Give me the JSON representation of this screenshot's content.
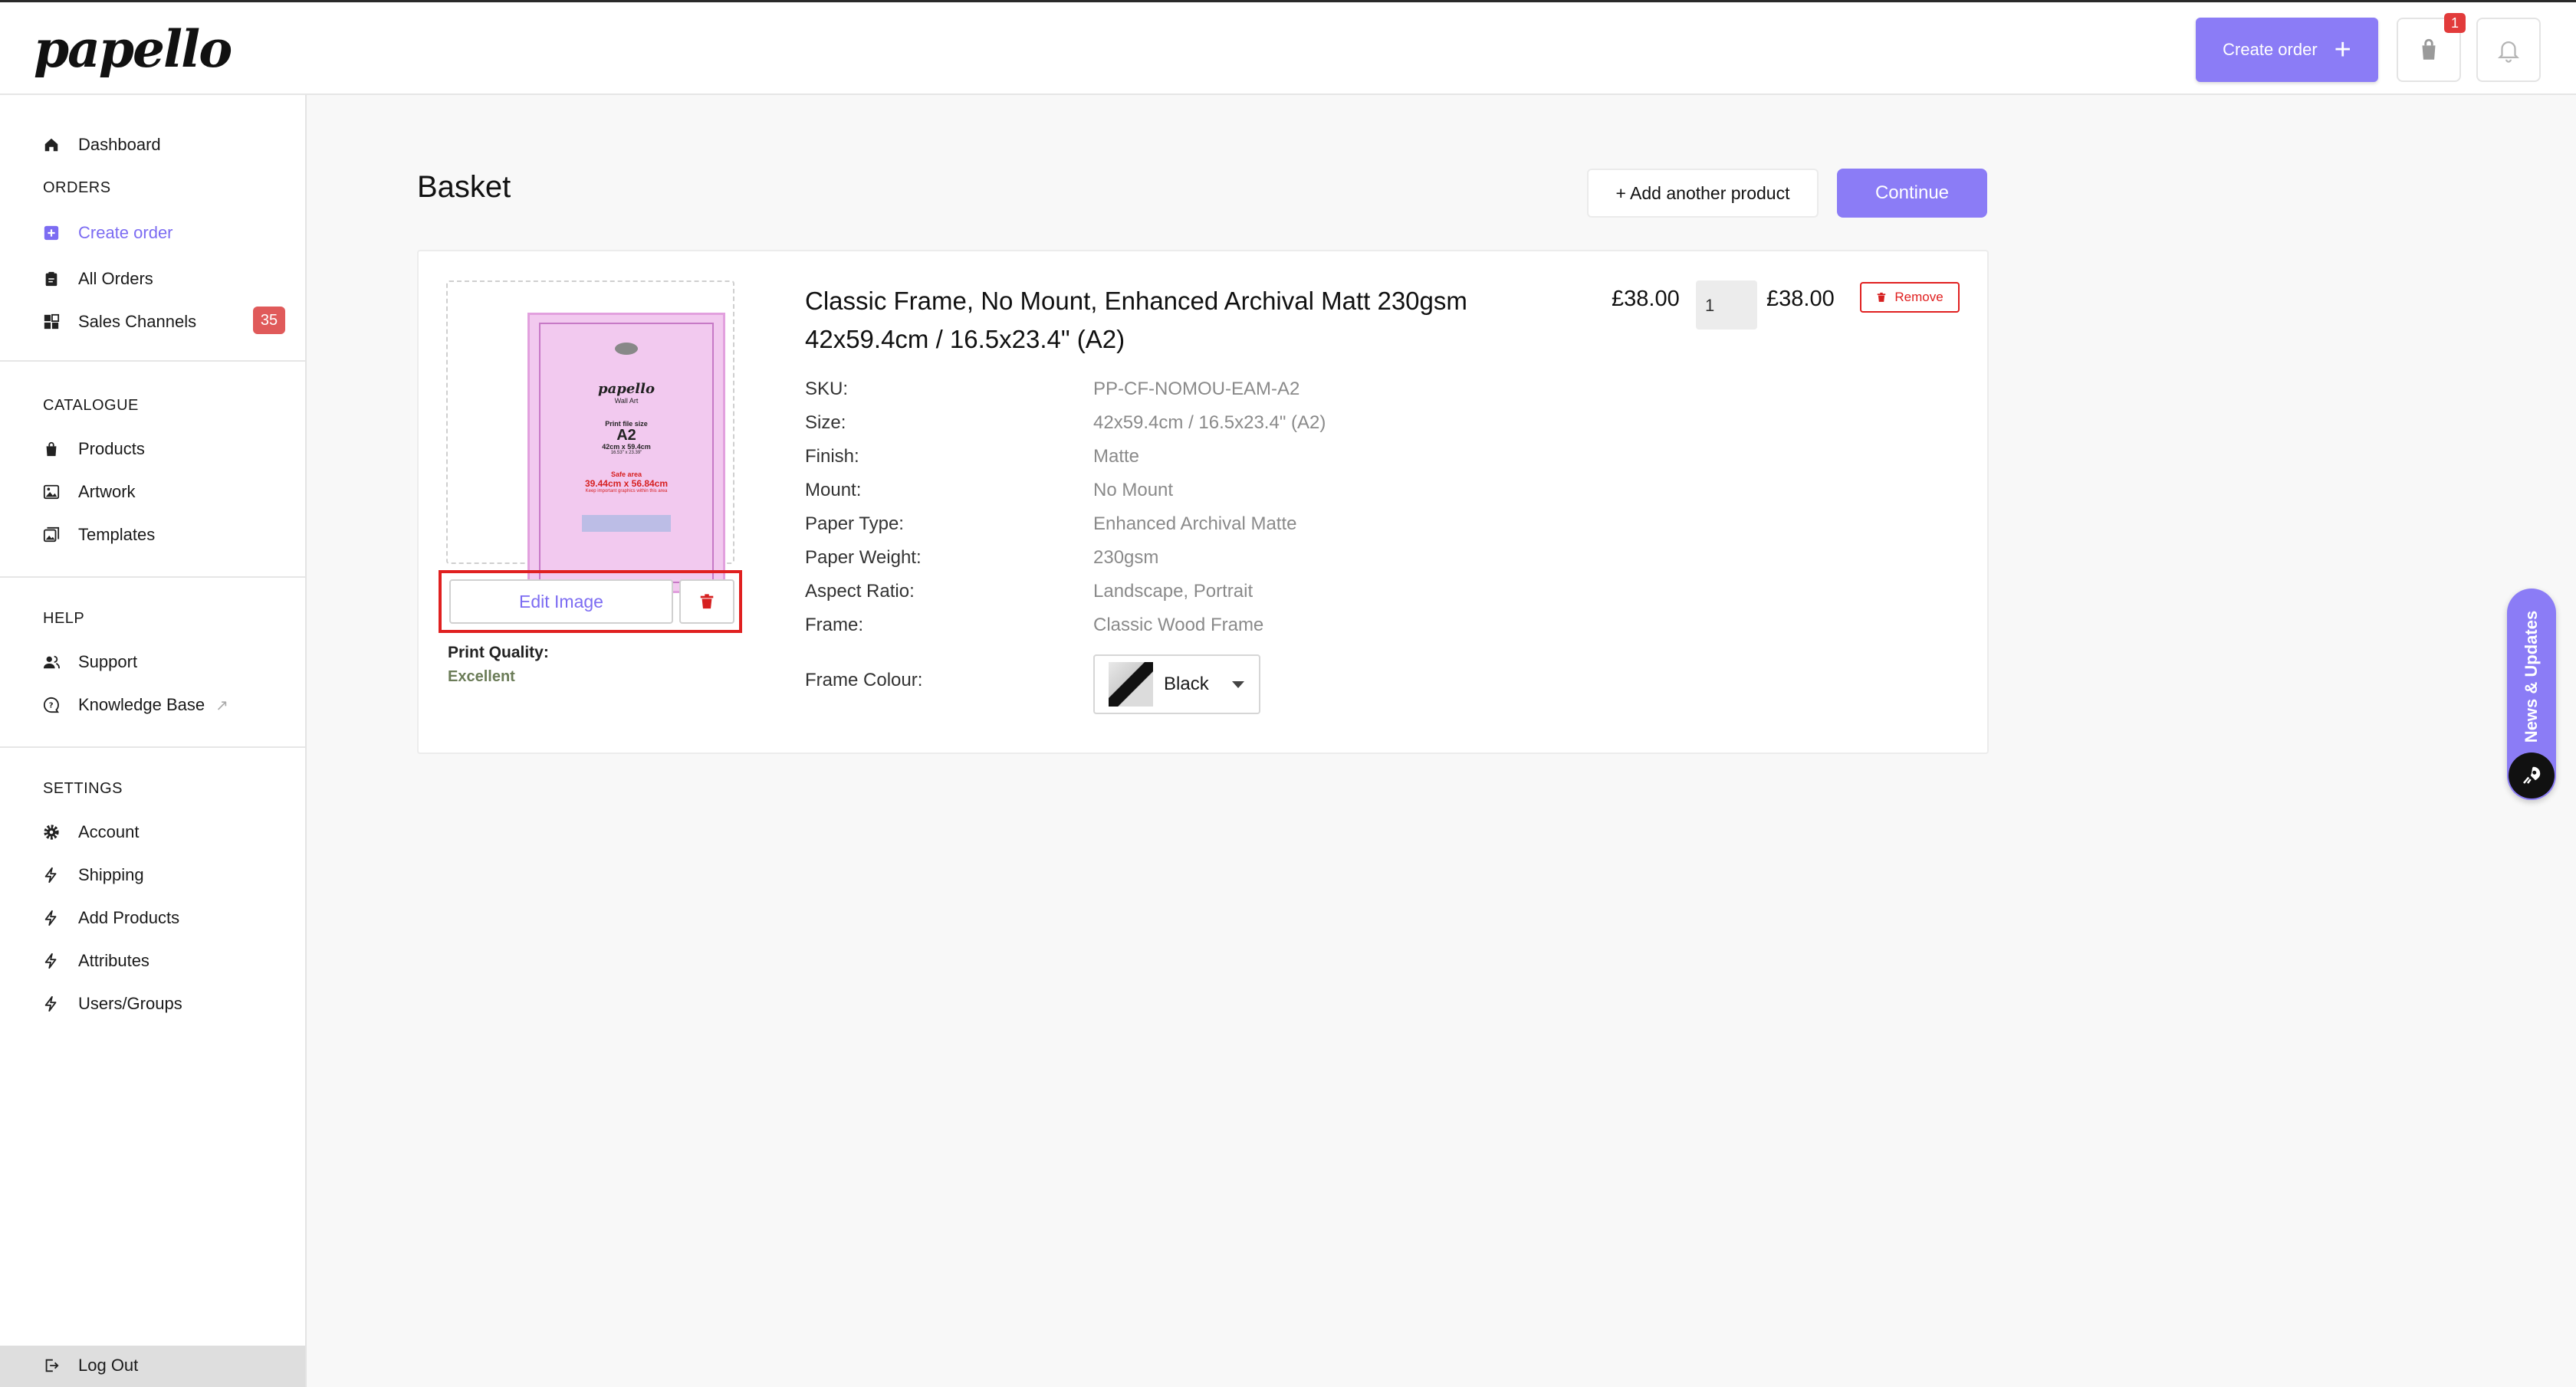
{
  "app": {
    "logo": "papello"
  },
  "header": {
    "create_order_label": "Create order",
    "create_order_icon": "plus-icon",
    "basket_count": "1",
    "basket_icon": "shopping-bag-icon",
    "bell_icon": "bell-icon"
  },
  "sidebar": {
    "dashboard": "Dashboard",
    "orders_header": "ORDERS",
    "create_order": "Create order",
    "all_orders": "All Orders",
    "sales_channels": "Sales Channels",
    "sales_channels_count": "35",
    "catalogue_header": "CATALOGUE",
    "products": "Products",
    "artwork": "Artwork",
    "templates": "Templates",
    "help_header": "HELP",
    "support": "Support",
    "knowledge_base": "Knowledge Base",
    "settings_header": "SETTINGS",
    "account": "Account",
    "shipping": "Shipping",
    "add_products": "Add Products",
    "attributes": "Attributes",
    "users_groups": "Users/Groups",
    "log_out": "Log Out"
  },
  "main": {
    "title": "Basket",
    "add_another_product": "+ Add another product",
    "continue": "Continue"
  },
  "item": {
    "title_line1": "Classic Frame, No Mount, Enhanced Archival Matt 230gsm",
    "title_line2": "42x59.4cm / 16.5x23.4\" (A2)",
    "unit_price": "£38.00",
    "quantity": "1",
    "total_price": "£38.00",
    "remove_label": "Remove",
    "edit_image_label": "Edit Image",
    "print_quality_label": "Print Quality:",
    "print_quality_value": "Excellent",
    "attributes": [
      {
        "key": "SKU:",
        "value": "PP-CF-NOMOU-EAM-A2"
      },
      {
        "key": "Size:",
        "value": "42x59.4cm / 16.5x23.4\" (A2)"
      },
      {
        "key": "Finish:",
        "value": "Matte"
      },
      {
        "key": "Mount:",
        "value": "No Mount"
      },
      {
        "key": "Paper Type:",
        "value": "Enhanced Archival Matte"
      },
      {
        "key": "Paper Weight:",
        "value": "230gsm"
      },
      {
        "key": "Aspect Ratio:",
        "value": "Landscape, Portrait"
      },
      {
        "key": "Frame:",
        "value": "Classic Wood Frame"
      }
    ],
    "frame_colour_label": "Frame Colour:",
    "frame_colour_value": "Black"
  },
  "poster": {
    "logo": "papello",
    "subtitle": "Wall Art",
    "print_file_size": "Print file size",
    "size_name": "A2",
    "size_cm": "42cm x 59.4cm",
    "size_in": "16.53\" x 23.39\"",
    "safe_area": "Safe area",
    "safe_dim": "39.44cm x 56.84cm",
    "keep_text": "Keep important graphics within this area"
  },
  "news_tab": {
    "label": "News & Updates"
  },
  "colors": {
    "accent": "#8b7cf6",
    "danger": "#e02020",
    "badge": "#e05a5a",
    "quality_good": "#6b7c58"
  }
}
